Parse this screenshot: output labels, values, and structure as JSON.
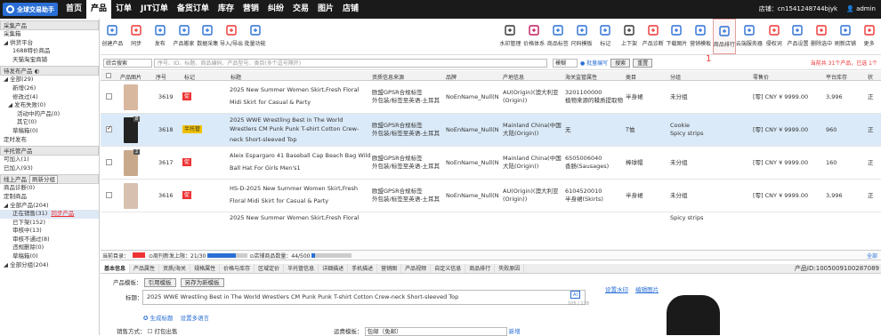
{
  "topnav": {
    "logo_label": "全球交易助手",
    "items": [
      "首页",
      "产品",
      "订单",
      "JIT订单",
      "备货订单",
      "库存",
      "营销",
      "纠纷",
      "交易",
      "图片",
      "店铺"
    ],
    "active_index": 1,
    "store": "店铺：cn1541248744bjyk",
    "user": "admin"
  },
  "toolbar": {
    "left": [
      "创建产品",
      "同步",
      "发布",
      "产品搬家",
      "数据采集",
      "导入/导出",
      "批量功能"
    ],
    "right": [
      "水印管理",
      "价格体系",
      "商品标签",
      "尺码模板",
      "标记",
      "上下架",
      "产品诊断",
      "下载图片",
      "营销模板",
      "商品排行",
      "云端服务器",
      "侵权词",
      "产品设置",
      "删除选中",
      "刷新店铺",
      "更多"
    ],
    "highlight_index": 9,
    "mark": "1"
  },
  "sidebar": {
    "sections": [
      {
        "head": "采集产品",
        "items": [
          {
            "label": "采集箱",
            "indent": 0
          },
          {
            "label": "◢ 供货平台",
            "indent": 0
          },
          {
            "label": "1688特价商品",
            "indent": 2
          },
          {
            "label": "天猫淘宝商铺",
            "indent": 2
          }
        ]
      },
      {
        "head": "待发布产品 ◐",
        "items": [
          {
            "label": "◢ 全部(29)",
            "indent": 0
          },
          {
            "label": "新增(26)",
            "indent": 2
          },
          {
            "label": "修改过(4)",
            "indent": 2
          },
          {
            "label": "◢ 发布失败(0)",
            "indent": 1
          },
          {
            "label": "活动中的产品(0)",
            "indent": 3
          },
          {
            "label": "其它(0)",
            "indent": 3
          },
          {
            "label": "草稿箱(0)",
            "indent": 2
          },
          {
            "label": "定时发布",
            "indent": 0
          }
        ]
      },
      {
        "head": "半托管产品",
        "items": [
          {
            "label": "可加入(1)",
            "indent": 0
          },
          {
            "label": "已加入(93)",
            "indent": 0
          }
        ]
      },
      {
        "head": "线上产品",
        "button": "刷新分组",
        "items": [
          {
            "label": "商品诊断(0)",
            "indent": 0
          },
          {
            "label": "定制商品",
            "indent": 0
          },
          {
            "label": "◢ 全部产品(204)",
            "indent": 0
          },
          {
            "label": "正在销售(31)",
            "red": "同步产品",
            "indent": 2,
            "selected": true
          },
          {
            "label": "已下架(152)",
            "indent": 2
          },
          {
            "label": "审核中(13)",
            "indent": 2
          },
          {
            "label": "审核不通过(8)",
            "indent": 2
          },
          {
            "label": "违规删除(0)",
            "indent": 2
          },
          {
            "label": "草稿箱(0)",
            "indent": 2
          },
          {
            "label": "◢ 全部分组(204)",
            "indent": 0
          }
        ]
      }
    ]
  },
  "filter": {
    "scope": "综合搜索",
    "placeholder": "序号、ID、标题、商品编码、产品型号、类目(多个逗号隔开)",
    "mode": "模糊",
    "batch": "批量编写",
    "search": "搜索",
    "reset": "重置",
    "summary": "当前共 31个产品，已选 1个"
  },
  "table": {
    "headers": [
      "产品图片",
      "序号",
      "标记",
      "标题",
      "资质信息来源",
      "品牌",
      "产地信息",
      "海关监管属性",
      "类目",
      "分组",
      "零售价",
      "平台库存",
      "状"
    ],
    "rows": [
      {
        "seq": "3619",
        "mark": "促",
        "title1": "2025 New Summer Women Skirt,Fresh Floral",
        "title2": "Midi Skirt for Casual & Party",
        "src1": "欧盟GPSR合规标签",
        "src2": "外包装/标签至英语-土耳其",
        "brand": "NoEnName_Null(N",
        "origin1": "AU(Origin)(澳大利亚",
        "origin2": "(Origin))",
        "customs1": "3201100000",
        "customs2": "植物来源的鞣质提取物",
        "cat": "半身裙",
        "group": "未分组",
        "group2": "",
        "price": "[零] CNY ¥ 9999.00",
        "stock": "3,996",
        "state": "正",
        "thumb": "#d9b8a0",
        "count": ""
      },
      {
        "seq": "3618",
        "mark": "半托管",
        "title1": "2025 WWE Wrestling Best in The World",
        "title2": "Wrestlers CM Punk Punk T-shirt Cotton Crew-",
        "title3": "neck Short-sleeved Top",
        "src1": "欧盟GPSR合规标签",
        "src2": "外包装/标签至英语-土耳其",
        "brand": "NoEnName_Null(N",
        "origin1": "Mainland China(中国",
        "origin2": "大陆(Origin))",
        "customs1": "无",
        "customs2": "",
        "cat": "T恤",
        "group": "Cookie",
        "group2": "Spicy strips",
        "price": "[零] CNY ¥ 9999.00",
        "stock": "960",
        "state": "正",
        "thumb": "#222",
        "count": "8"
      },
      {
        "seq": "3617",
        "mark": "促",
        "title1": "Aleix Espargaro 41 Baseball Cap Beach Bag Wild",
        "title2": "Ball Hat For Girls Men's1",
        "src1": "欧盟GPSR合规标签",
        "src2": "外包装/标签至英语-土耳其",
        "brand": "NoEnName_Null(N",
        "origin1": "Mainland China(中国",
        "origin2": "大陆(Origin))",
        "customs1": "6505006040",
        "customs2": "香肠(Sausages)",
        "cat": "棒球帽",
        "group": "未分组",
        "group2": "",
        "price": "[零] CNY ¥ 9999.00",
        "stock": "160",
        "state": "正",
        "thumb": "#c9a98c",
        "count": "2"
      },
      {
        "seq": "3616",
        "mark": "促",
        "title1": "HS-D-2025 New Summer Women Skirt,Fresh",
        "title2": "Floral Midi Skirt for Casual & Party",
        "src1": "欧盟GPSR合规标签",
        "src2": "外包装/标签至英语-土耳其",
        "brand": "NoEnName_Null(N",
        "origin1": "AU(Origin)(澳大利亚",
        "origin2": "(Origin))",
        "customs1": "6104520010",
        "customs2": "半身裙(Skirts)",
        "cat": "半身裙",
        "group": "未分组",
        "group2": "",
        "price": "[零] CNY ¥ 9999.00",
        "stock": "3,996",
        "state": "正",
        "thumb": "#d8c0b0",
        "count": ""
      }
    ],
    "next_row_title": "2025 New Summer Women Skirt,Fresh Floral",
    "next_row_group": "Spicy strips"
  },
  "status": {
    "current": "当前目录：",
    "weekly": "⊙周刊新发上限：21/30",
    "store": "⊙店铺商品数量：44/500",
    "weekly_fill": 0.7,
    "store_fill": 0.088,
    "right": "全部"
  },
  "tabs": [
    "基本信息",
    "产品属性",
    "资质/海关",
    "规格属性",
    "价格与库存",
    "区域定价",
    "半托管信息",
    "详细描述",
    "手机描述",
    "营销图",
    "产品视频",
    "自定义信息",
    "商品排行",
    "失败原因"
  ],
  "detail": {
    "product_id": "产品ID:1005009100287089",
    "template_label": "产品模板：",
    "template": "引用模板",
    "save_as": "另存为新模板",
    "title_label": "标题：",
    "title_value": "2025 WWE Wrestling Best in The World Wrestlers CM Punk Punk T-shirt Cotton Crew-neck Short-sleeved Top",
    "counter": "105 / 128",
    "gen_title": "生成标题",
    "set_lang": "设置多语言",
    "sale_label": "销售方式：",
    "sale_value": "打包出售",
    "ship_label": "运费模板：",
    "ship_value": "包邮（免邮）",
    "new": "新增",
    "watermark": "设置水印",
    "edit_image": "编辑图片"
  },
  "colors": {
    "accent": "#2a6fd6",
    "red": "#e33333",
    "selected_row": "#dbeaf8"
  }
}
